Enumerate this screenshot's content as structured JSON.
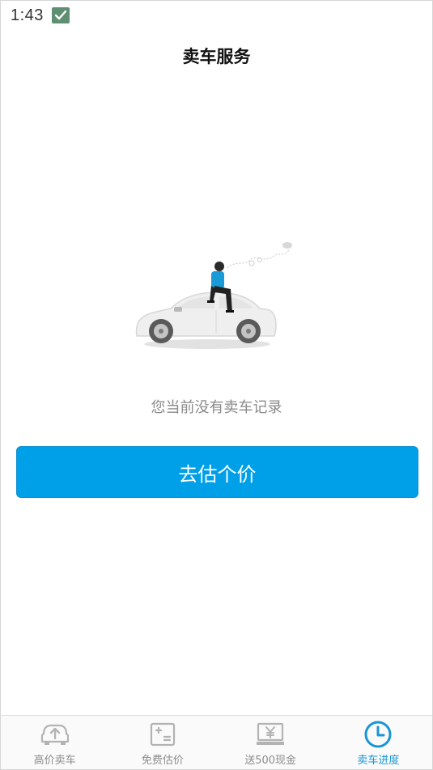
{
  "status_bar": {
    "time": "1:43",
    "app_icon": "checkmark-app-icon"
  },
  "header": {
    "title": "卖车服务"
  },
  "empty_state": {
    "illustration": "man-sitting-on-car-illustration",
    "message": "您当前没有卖车记录"
  },
  "actions": {
    "estimate_label": "去估个价"
  },
  "tab_bar": {
    "active_color": "#1996d6",
    "inactive_color": "#8c8c8c",
    "items": [
      {
        "label": "高价卖车",
        "icon": "car-upload-icon"
      },
      {
        "label": "免费估价",
        "icon": "calculator-icon"
      },
      {
        "label": "送500现金",
        "icon": "yen-cash-icon"
      },
      {
        "label": "卖车进度",
        "icon": "clock-icon",
        "active": true
      }
    ]
  },
  "colors": {
    "primary_button": "#00a0e9"
  }
}
